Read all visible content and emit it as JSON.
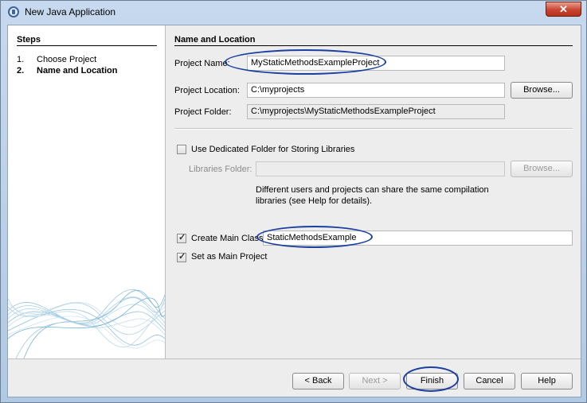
{
  "window": {
    "title": "New Java Application",
    "close_glyph": "✕"
  },
  "steps": {
    "title": "Steps",
    "items": [
      {
        "num": "1.",
        "label": "Choose Project",
        "active": false
      },
      {
        "num": "2.",
        "label": "Name and Location",
        "active": true
      }
    ]
  },
  "form": {
    "section_title": "Name and Location",
    "project_name_label": "Project Name:",
    "project_name_value": "MyStaticMethodsExampleProject",
    "project_location_label": "Project Location:",
    "project_location_value": "C:\\myprojects",
    "browse_label": "Browse...",
    "project_folder_label": "Project Folder:",
    "project_folder_value": "C:\\myprojects\\MyStaticMethodsExampleProject",
    "dedicated_folder_label": "Use Dedicated Folder for Storing Libraries",
    "dedicated_folder_checked": false,
    "libraries_folder_label": "Libraries Folder:",
    "libraries_folder_value": "",
    "libraries_browse_label": "Browse...",
    "libraries_help": "Different users and projects can share the same compilation libraries (see Help for details).",
    "create_main_class_label": "Create Main Class",
    "create_main_class_checked": true,
    "main_class_value": "StaticMethodsExample",
    "set_main_project_label": "Set as Main Project",
    "set_main_project_checked": true
  },
  "buttons": {
    "back": "< Back",
    "next": "Next >",
    "finish": "Finish",
    "cancel": "Cancel",
    "help": "Help"
  },
  "annotation_color": "#1a3fa0"
}
